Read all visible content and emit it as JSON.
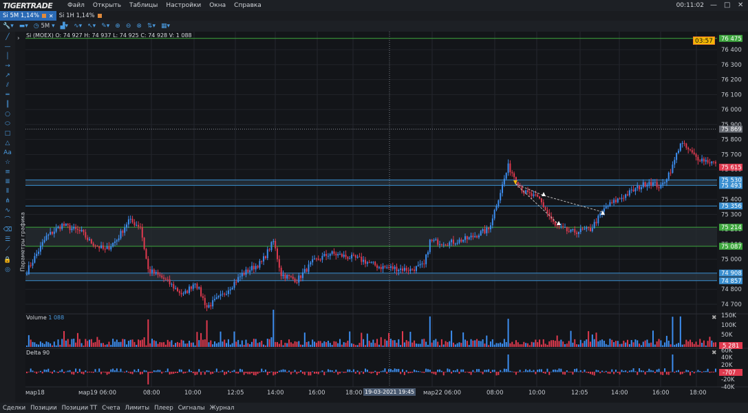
{
  "menubar": {
    "logo": "TIGERTRADE",
    "items": [
      "Файл",
      "Открыть",
      "Таблицы",
      "Настройки",
      "Окна",
      "Справка"
    ],
    "clock": "00:11:02"
  },
  "tabs": [
    {
      "label": "Si 5M  1,14%",
      "active": true
    },
    {
      "label": "Si 1H  1,14%",
      "active": false
    }
  ],
  "toolbar": {
    "timeframe": "5M"
  },
  "chart": {
    "info": "Si (MOEX) O: 74 927  H: 74 937  L: 74 925  C: 74 928  V: 1 088",
    "timer": "03:57",
    "params_label": "Параметры графика",
    "crosshair_time": "19-03-2021 19:45",
    "volume_label": "Volume",
    "volume_value": "1 088",
    "delta_label": "Delta 90"
  },
  "colors": {
    "up": "#3d8ef0",
    "down": "#e03a4f",
    "green_level": "#3fa83f",
    "blue_level": "#3a8fd0",
    "accent": "#2a6ab5"
  },
  "price_axis": {
    "ticks": [
      76400,
      76300,
      76200,
      76100,
      76000,
      75900,
      75800,
      75700,
      75600,
      75500,
      75400,
      75300,
      75200,
      75100,
      75000,
      74900,
      74800,
      74700
    ],
    "ylim": [
      74640,
      76520
    ],
    "tags": [
      {
        "price": 76475,
        "label": "76 475",
        "color": "#3fa83f"
      },
      {
        "price": 75869,
        "label": "75 869",
        "color": "#6a6e76"
      },
      {
        "price": 75615,
        "label": "75 615",
        "color": "#e03a4f"
      },
      {
        "price": 75530,
        "label": "75 530",
        "color": "#3a8fd0"
      },
      {
        "price": 75493,
        "label": "75 493",
        "color": "#3a8fd0"
      },
      {
        "price": 75356,
        "label": "75 356",
        "color": "#3a8fd0"
      },
      {
        "price": 75214,
        "label": "75 214",
        "color": "#3fa83f"
      },
      {
        "price": 75087,
        "label": "75 087",
        "color": "#3fa83f"
      },
      {
        "price": 74908,
        "label": "74 908",
        "color": "#3a8fd0"
      },
      {
        "price": 74857,
        "label": "74 857",
        "color": "#3a8fd0"
      }
    ],
    "levels": [
      {
        "price": 76475,
        "type": "green"
      },
      {
        "price": 75869,
        "type": "dotted"
      },
      {
        "price": 75530,
        "type": "blue"
      },
      {
        "price": 75493,
        "type": "blue"
      },
      {
        "price": 75356,
        "type": "blue"
      },
      {
        "price": 75214,
        "type": "green"
      },
      {
        "price": 75087,
        "type": "green"
      },
      {
        "price": 74908,
        "type": "blue"
      },
      {
        "price": 74857,
        "type": "blue"
      }
    ]
  },
  "volume_axis": {
    "ticks": [
      "150K",
      "100K",
      "50K"
    ],
    "tag": "5 281"
  },
  "delta_axis": {
    "ticks": [
      "60K",
      "40K",
      "20K",
      "0K",
      "-20K",
      "-40K"
    ],
    "tag": "-707"
  },
  "time_axis": [
    "мар18",
    "мар19  06:00",
    "08:00",
    "10:00",
    "12:05",
    "14:00",
    "16:00",
    "18:00",
    "мар22  06:00",
    "08:00",
    "10:00",
    "12:05",
    "14:00",
    "16:00",
    "18:00"
  ],
  "chart_data": {
    "type": "candlestick",
    "title": "Si (MOEX)",
    "anchors": [
      {
        "i": 0,
        "p": 74920
      },
      {
        "i": 10,
        "p": 75150
      },
      {
        "i": 18,
        "p": 75230
      },
      {
        "i": 28,
        "p": 75180
      },
      {
        "i": 32,
        "p": 75120
      },
      {
        "i": 40,
        "p": 75060
      },
      {
        "i": 46,
        "p": 75130
      },
      {
        "i": 52,
        "p": 75260
      },
      {
        "i": 58,
        "p": 75220
      },
      {
        "i": 62,
        "p": 74930
      },
      {
        "i": 70,
        "p": 74870
      },
      {
        "i": 80,
        "p": 74760
      },
      {
        "i": 86,
        "p": 74850
      },
      {
        "i": 92,
        "p": 74680
      },
      {
        "i": 100,
        "p": 74760
      },
      {
        "i": 110,
        "p": 74900
      },
      {
        "i": 120,
        "p": 74980
      },
      {
        "i": 126,
        "p": 75120
      },
      {
        "i": 130,
        "p": 74900
      },
      {
        "i": 138,
        "p": 74860
      },
      {
        "i": 146,
        "p": 74980
      },
      {
        "i": 155,
        "p": 75040
      },
      {
        "i": 170,
        "p": 75000
      },
      {
        "i": 180,
        "p": 74950
      },
      {
        "i": 196,
        "p": 74930
      },
      {
        "i": 203,
        "p": 74960
      },
      {
        "i": 206,
        "p": 75120
      },
      {
        "i": 216,
        "p": 75110
      },
      {
        "i": 226,
        "p": 75140
      },
      {
        "i": 236,
        "p": 75200
      },
      {
        "i": 246,
        "p": 75620
      },
      {
        "i": 254,
        "p": 75450
      },
      {
        "i": 262,
        "p": 75400
      },
      {
        "i": 270,
        "p": 75220
      },
      {
        "i": 278,
        "p": 75180
      },
      {
        "i": 288,
        "p": 75200
      },
      {
        "i": 296,
        "p": 75350
      },
      {
        "i": 306,
        "p": 75430
      },
      {
        "i": 318,
        "p": 75520
      },
      {
        "i": 324,
        "p": 75480
      },
      {
        "i": 330,
        "p": 75620
      },
      {
        "i": 334,
        "p": 75780
      },
      {
        "i": 342,
        "p": 75680
      },
      {
        "i": 352,
        "p": 75640
      }
    ],
    "count": 353
  },
  "bottombar": [
    "Сделки",
    "Позиции",
    "Позиции ТТ",
    "Счета",
    "Лимиты",
    "Плеер",
    "Сигналы",
    "Журнал"
  ]
}
